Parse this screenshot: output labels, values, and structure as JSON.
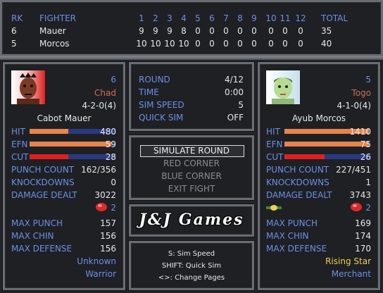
{
  "score": {
    "header": {
      "rk": "RK",
      "fighter": "FIGHTER",
      "rounds": [
        "1",
        "2",
        "3",
        "4",
        "5",
        "6",
        "7",
        "8",
        "9",
        "10",
        "11",
        "12"
      ],
      "total": "TOTAL"
    },
    "rows": [
      {
        "rk": "6",
        "name": "Mauer",
        "scores": [
          "9",
          "9",
          "9",
          "8",
          "0",
          "0",
          "0",
          "0",
          "0",
          "0",
          "0",
          "0"
        ],
        "total": "35"
      },
      {
        "rk": "5",
        "name": "Morcos",
        "scores": [
          "10",
          "10",
          "10",
          "10",
          "0",
          "0",
          "0",
          "0",
          "0",
          "0",
          "0",
          "0"
        ],
        "total": "40"
      }
    ]
  },
  "left": {
    "rank": "6",
    "first": "Chad",
    "record": "4-2-0(4)",
    "full_name": "Cabot Mauer",
    "hit_label": "HIT",
    "hit": "480",
    "efn_label": "EFN",
    "efn": "59",
    "cut_label": "CUT",
    "cut": "28",
    "hit_fill": 0.45,
    "efn_fill": 0.95,
    "cut_fill": 0.45,
    "punch_count_label": "PUNCH COUNT",
    "punch_count": "162/356",
    "knockdowns_label": "KNOCKDOWNS",
    "knockdowns": "0",
    "damage_label": "DAMAGE DEALT",
    "damage": "3022",
    "gloves": "2",
    "max_punch_label": "MAX PUNCH",
    "max_punch": "157",
    "max_chin_label": "MAX CHIN",
    "max_chin": "156",
    "max_def_label": "MAX DEFENSE",
    "max_def": "156",
    "status": "Unknown",
    "style": "Warrior"
  },
  "right": {
    "rank": "5",
    "first": "Togo",
    "record": "4-1-0(4)",
    "full_name": "Ayub Morcos",
    "hit_label": "HIT",
    "hit": "1410",
    "efn_label": "EFN",
    "efn": "75",
    "cut_label": "CUT",
    "cut": "26",
    "hit_fill": 0.98,
    "efn_fill": 0.98,
    "cut_fill": 0.47,
    "punch_count_label": "PUNCH COUNT",
    "punch_count": "227/451",
    "knockdowns_label": "KNOCKDOWNS",
    "knockdowns": "1",
    "damage_label": "DAMAGE DEALT",
    "damage": "3743",
    "gloves": "2",
    "max_punch_label": "MAX PUNCH",
    "max_punch": "169",
    "max_chin_label": "MAX CHIN",
    "max_chin": "174",
    "max_def_label": "MAX DEFENSE",
    "max_def": "170",
    "status": "Rising Star",
    "style": "Merchant"
  },
  "info": {
    "round_label": "ROUND",
    "round": "4/12",
    "time_label": "TIME",
    "time": "0:00",
    "speed_label": "SIM SPEED",
    "speed": "5",
    "quick_label": "QUICK SIM",
    "quick": "OFF"
  },
  "menu": {
    "simulate": "SIMULATE ROUND",
    "red": "RED CORNER",
    "blue": "BLUE CORNER",
    "exit": "EXIT FIGHT"
  },
  "logo": {
    "text": "J&J Games"
  },
  "help": {
    "line1": "S: Sim Speed",
    "line2": "SHIFT: Quick Sim",
    "line3": "<>: Change Pages"
  },
  "colors": {
    "blue_text": "#6f8fe8",
    "red_text": "#e04040",
    "rank_orange": "#d06a5a",
    "hit_bar": "#e8844e",
    "cut_bar": "#e02020",
    "gold": "#f0d050"
  }
}
